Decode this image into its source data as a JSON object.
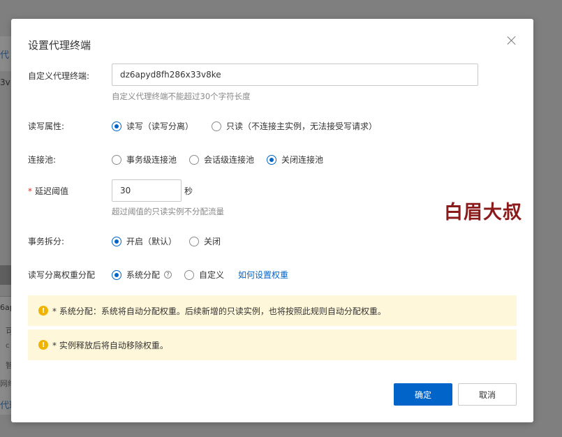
{
  "background": {
    "fragments": [
      "代",
      "3v",
      "6ap",
      "可",
      "c",
      "智",
      "网络",
      "代理"
    ]
  },
  "dialog": {
    "title": "设置代理终端",
    "custom_endpoint": {
      "label": "自定义代理终端:",
      "value": "dz6apyd8fh286x33v8ke",
      "hint": "自定义代理终端不能超过30个字符长度"
    },
    "rw_attr": {
      "label": "读写属性:",
      "options": [
        "读写（读写分离）",
        "只读（不连接主实例，无法接受写请求）"
      ],
      "selected": "读写（读写分离）"
    },
    "conn_pool": {
      "label": "连接池:",
      "options": [
        "事务级连接池",
        "会话级连接池",
        "关闭连接池"
      ],
      "selected": "关闭连接池"
    },
    "latency": {
      "required_mark": "*",
      "label": "延迟阈值",
      "value": "30",
      "unit": "秒",
      "hint": "超过阈值的只读实例不分配流量"
    },
    "txn_split": {
      "label": "事务拆分:",
      "options": [
        "开启（默认）",
        "关闭"
      ],
      "selected": "开启（默认）"
    },
    "weight": {
      "label": "读写分离权重分配",
      "options": [
        "系统分配",
        "自定义"
      ],
      "selected": "系统分配",
      "help_icon": "question-circle-icon",
      "link": "如何设置权重"
    },
    "notices": [
      "* 系统分配：系统将自动分配权重。后续新增的只读实例，也将按照此规则自动分配权重。",
      "* 实例释放后将自动移除权重。"
    ],
    "buttons": {
      "confirm": "确定",
      "cancel": "取消"
    }
  },
  "watermark": "白眉大叔",
  "colors": {
    "primary": "#0064c8",
    "notice_bg": "#fff7d9",
    "warn": "#f0b400",
    "watermark": "#8b1a1a"
  }
}
